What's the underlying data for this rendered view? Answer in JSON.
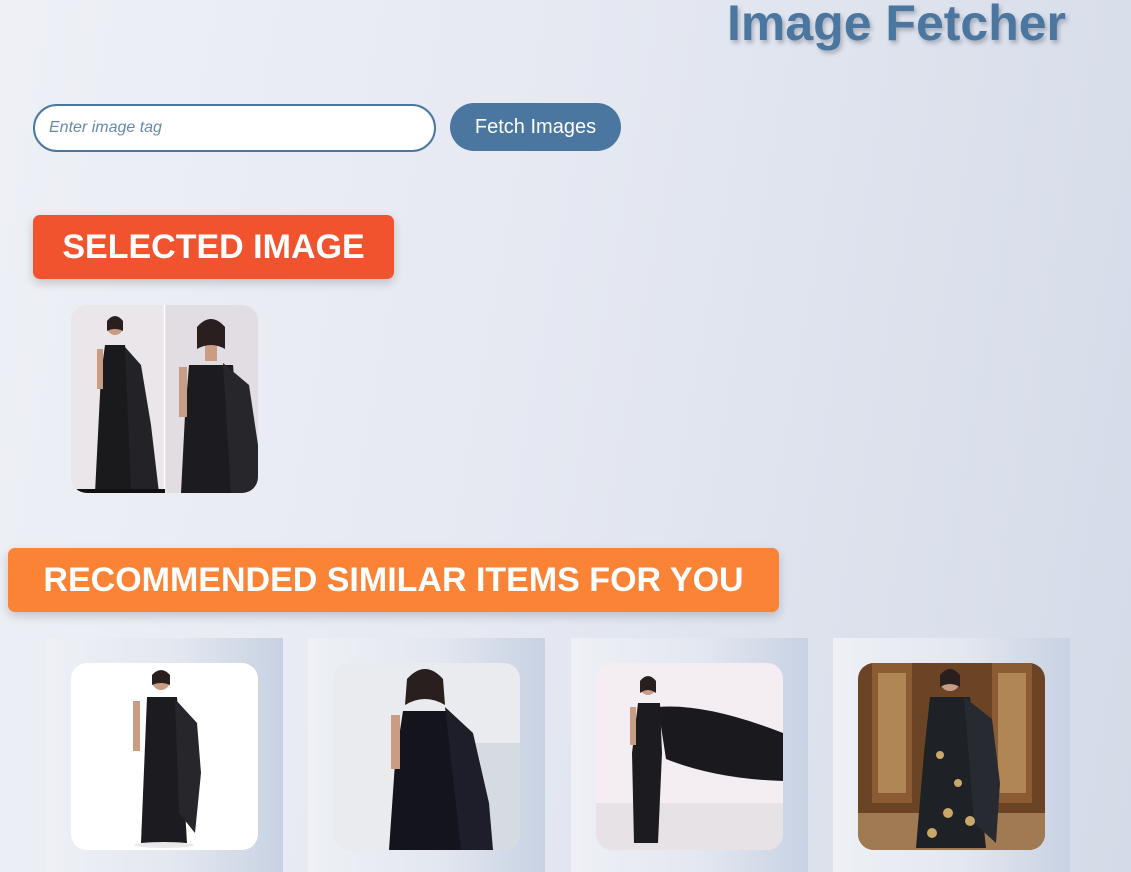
{
  "header": {
    "title": "Image Fetcher"
  },
  "search": {
    "placeholder": "Enter image tag",
    "value": "",
    "button_label": "Fetch Images"
  },
  "selected_section": {
    "heading": "SELECTED IMAGE",
    "color": "#f2532f",
    "image": {
      "description_icon": "saree-photo-icon"
    }
  },
  "recommended_section": {
    "heading": "RECOMMENDED SIMILAR ITEMS FOR YOU",
    "color": "#fb8336",
    "items": [
      {
        "icon": "saree-photo-icon"
      },
      {
        "icon": "saree-photo-icon"
      },
      {
        "icon": "saree-photo-icon"
      },
      {
        "icon": "saree-photo-icon"
      }
    ]
  },
  "colors": {
    "accent": "#4a76a0",
    "background": "#e6e9f2"
  }
}
